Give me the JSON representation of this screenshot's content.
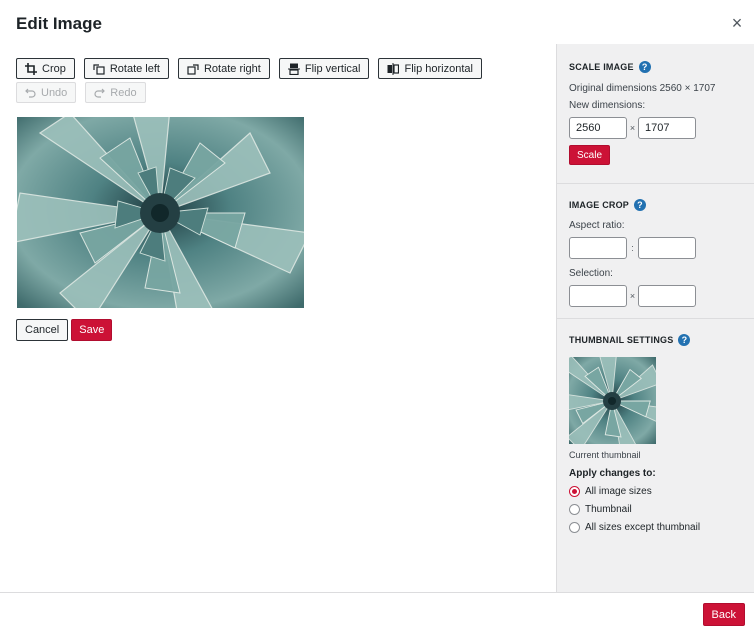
{
  "header": {
    "title": "Edit Image",
    "close_glyph": "×"
  },
  "toolbar": {
    "crop": "Crop",
    "rotate_left": "Rotate left",
    "rotate_right": "Rotate right",
    "flip_vertical": "Flip vertical",
    "flip_horizontal": "Flip horizontal",
    "undo": "Undo",
    "redo": "Redo"
  },
  "image": {
    "subject": "agave-succulent-photo"
  },
  "actions": {
    "cancel": "Cancel",
    "save": "Save"
  },
  "sidebar": {
    "scale": {
      "title": "SCALE IMAGE",
      "original": "Original dimensions 2560 × 1707",
      "new_label": "New dimensions:",
      "width": "2560",
      "height": "1707",
      "separator": "×",
      "button": "Scale"
    },
    "crop": {
      "title": "IMAGE CROP",
      "aspect_label": "Aspect ratio:",
      "aspect_sep": ":",
      "aspect_w": "",
      "aspect_h": "",
      "selection_label": "Selection:",
      "selection_sep": "×",
      "sel_w": "",
      "sel_h": ""
    },
    "thumbnail": {
      "title": "THUMBNAIL SETTINGS",
      "caption": "Current thumbnail",
      "apply_label": "Apply changes to:",
      "options": [
        "All image sizes",
        "Thumbnail",
        "All sizes except thumbnail"
      ],
      "selected": "All image sizes"
    }
  },
  "footer": {
    "back": "Back"
  },
  "colors": {
    "accent": "#cc1236",
    "help": "#2271b1",
    "sidebar_bg": "#f0f0f1"
  },
  "icons": {
    "crop": "crop-icon",
    "rotate_left": "rotate-left-icon",
    "rotate_right": "rotate-right-icon",
    "flip_vertical": "flip-vertical-icon",
    "flip_horizontal": "flip-horizontal-icon",
    "undo": "undo-icon",
    "redo": "redo-icon",
    "help": "help-icon",
    "close": "close-icon"
  }
}
